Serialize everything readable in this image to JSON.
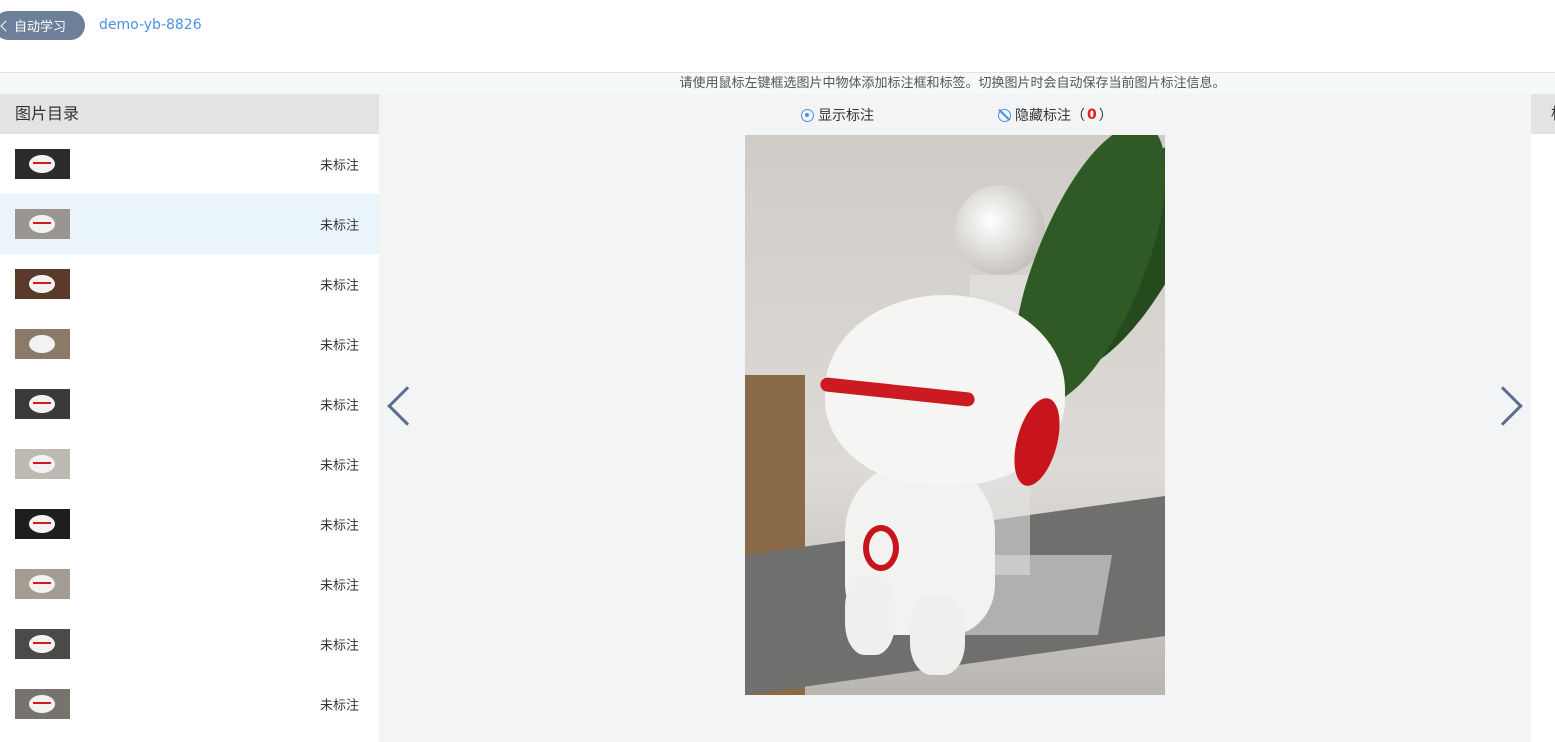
{
  "header": {
    "back_label": "自动学习",
    "dataset_name": "demo-yb-8826"
  },
  "tip": "请使用鼠标左键框选图片中物体添加标注框和标签。切换图片时会自动保存当前图片标注信息。",
  "sidebar": {
    "title": "图片目录",
    "items": [
      {
        "status": "未标注"
      },
      {
        "status": "未标注"
      },
      {
        "status": "未标注"
      },
      {
        "status": "未标注"
      },
      {
        "status": "未标注"
      },
      {
        "status": "未标注"
      },
      {
        "status": "未标注"
      },
      {
        "status": "未标注"
      },
      {
        "status": "未标注"
      },
      {
        "status": "未标注"
      }
    ]
  },
  "viewer": {
    "show_label": "显示标注",
    "hide_label": "隐藏标注",
    "paren_open": "（",
    "paren_close": "）",
    "annotation_count": "0"
  },
  "right_panel": {
    "title": "标"
  },
  "colors": {
    "accent": "#4a90e2",
    "back_button": "#6e7f99",
    "selected_row": "#eaf5fb",
    "count": "#e02020"
  },
  "icons": [
    "chevron-left-icon",
    "eye-icon",
    "eye-off-icon",
    "arrow-left-icon",
    "arrow-right-icon"
  ]
}
